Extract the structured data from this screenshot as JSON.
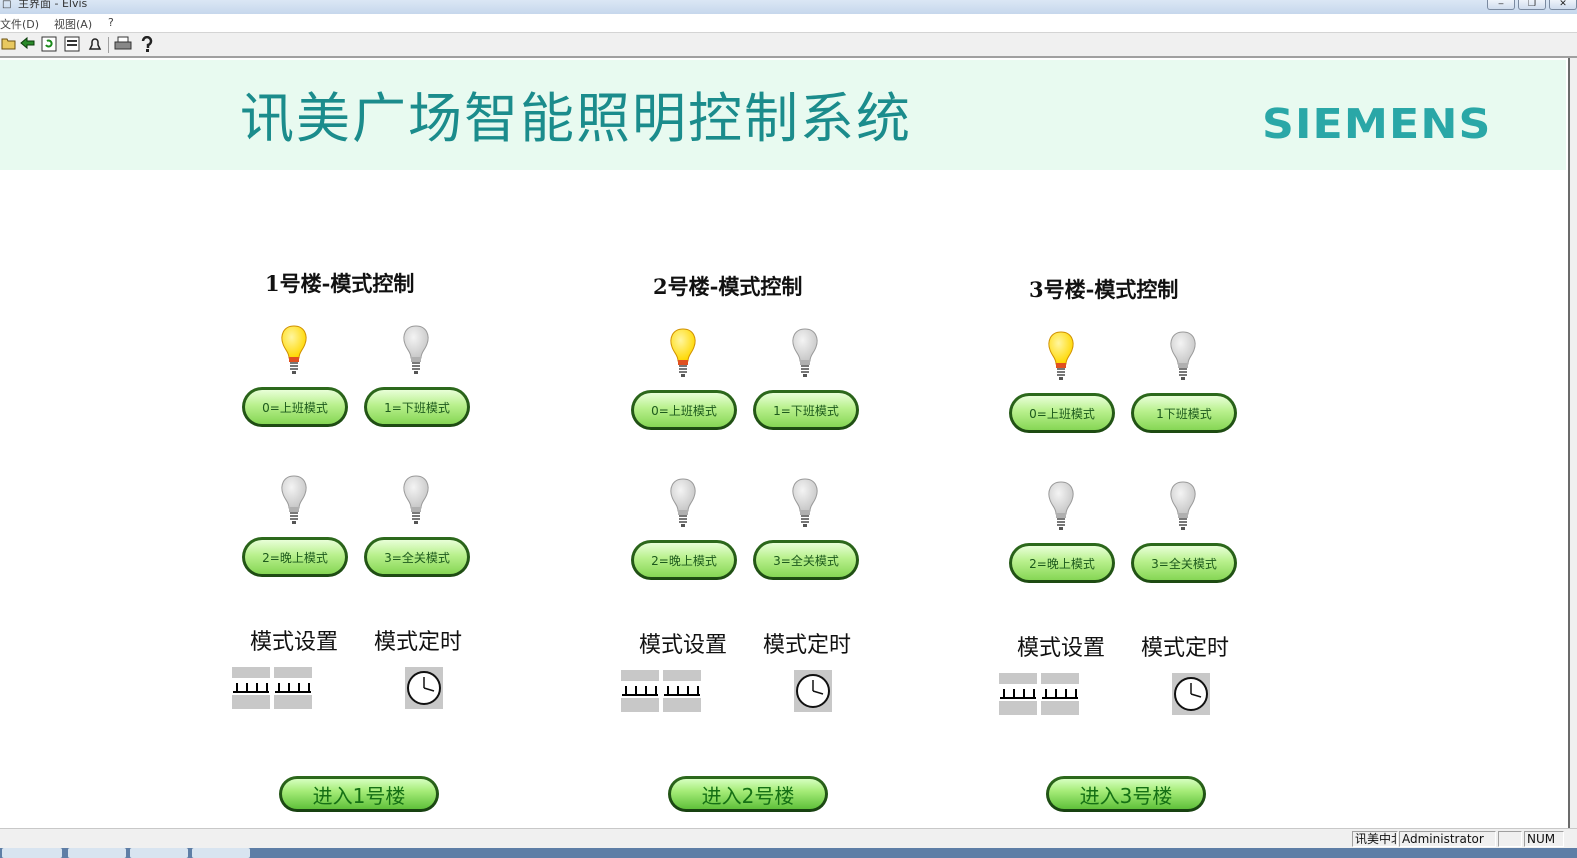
{
  "window": {
    "title": "主界面 - Elvis",
    "app_icon": "document-icon",
    "buttons": [
      "minimize",
      "restore",
      "close"
    ]
  },
  "menu": {
    "items": [
      "文件(D)",
      "视图(A)",
      "?"
    ]
  },
  "toolbar": {
    "icons": [
      "open-folder-icon",
      "back-arrow-icon",
      "refresh-icon",
      "report-icon",
      "alarm-bell-icon",
      "print-icon",
      "help-icon"
    ]
  },
  "header": {
    "title": "讯美广场智能照明控制系统",
    "logo": "SIEMENS"
  },
  "buildings": [
    {
      "title": "1号楼-模式控制",
      "modes": [
        {
          "label": "0=上班模式",
          "lit": true
        },
        {
          "label": "1=下班模式",
          "lit": false
        },
        {
          "label": "2=晚上模式",
          "lit": false
        },
        {
          "label": "3=全关模式",
          "lit": false
        }
      ],
      "setting_label": "模式设置",
      "timer_label": "模式定时",
      "enter_label": "进入1号楼"
    },
    {
      "title": "2号楼-模式控制",
      "modes": [
        {
          "label": "0=上班模式",
          "lit": true
        },
        {
          "label": "1=下班模式",
          "lit": false
        },
        {
          "label": "2=晚上模式",
          "lit": false
        },
        {
          "label": "3=全关模式",
          "lit": false
        }
      ],
      "setting_label": "模式设置",
      "timer_label": "模式定时",
      "enter_label": "进入2号楼"
    },
    {
      "title": "3号楼-模式控制",
      "modes": [
        {
          "label": "0=上班模式",
          "lit": true
        },
        {
          "label": "1下班模式",
          "lit": false
        },
        {
          "label": "2=晚上模式",
          "lit": false
        },
        {
          "label": "3=全关模式",
          "lit": false
        }
      ],
      "setting_label": "模式设置",
      "timer_label": "模式定时",
      "enter_label": "进入3号楼"
    }
  ],
  "statusbar": {
    "project": "讯美中北",
    "user": "Administrator",
    "num": "NUM"
  },
  "colors": {
    "header_bg": "#e8faf0",
    "title_teal": "#1b8c8c",
    "logo_teal": "#2aa7a7",
    "button_green": "#a6ec78",
    "bulb_on": "#ffd800",
    "bulb_off": "#c8c8c8"
  }
}
